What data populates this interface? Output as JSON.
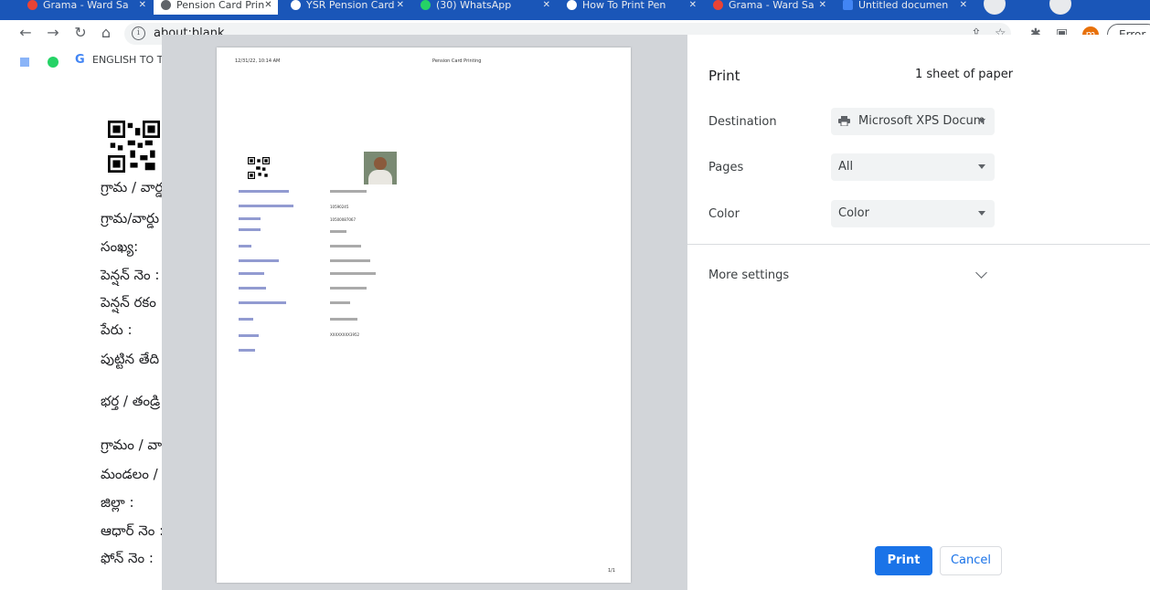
{
  "browser": {
    "tabs": [
      {
        "label": "Grama - Ward Sa",
        "favicon_color": "#ea4335"
      },
      {
        "label": "Pension Card Prin",
        "favicon_color": "#5f6368"
      },
      {
        "label": "YSR Pension Card",
        "favicon_color": "#5f6368"
      },
      {
        "label": "(30) WhatsApp",
        "favicon_color": "#25d366"
      },
      {
        "label": "How To Print Pen",
        "favicon_color": "#5f6368"
      },
      {
        "label": "Grama - Ward Sa",
        "favicon_color": "#ea4335"
      },
      {
        "label": "Untitled documen",
        "favicon_color": "#4285f4"
      }
    ],
    "tab_close": "✕",
    "url": "about:blank",
    "profile_initial": "m",
    "error_label": "Error",
    "bookmarks": {
      "g_letter": "G",
      "label": "ENGLISH TO TE"
    }
  },
  "page_labels": [
    "గ్రామ / వార్డ",
    "గ్రామ/వార్డు",
    "సంఖ్య:",
    "పెన్షన్ నెం :",
    "పెన్షన్ రకం",
    "పేరు :",
    "పుట్టిన తేది",
    "భర్త / తండ్రి",
    "గ్రామం / వా",
    "మండలం /",
    "జిల్లా :",
    "ఆధార్ నెం :",
    "ఫోన్ నెం :"
  ],
  "preview": {
    "header_left": "12/31/22, 10:14 AM",
    "header_center": "Pension Card Printing",
    "footer_page": "1/1",
    "values": [
      "10590245",
      "10500087067",
      "XXXXXXXX3952"
    ]
  },
  "print_panel": {
    "title": "Print",
    "sheets": "1 sheet of paper",
    "destination": {
      "label": "Destination",
      "value": "Microsoft XPS Docum"
    },
    "pages": {
      "label": "Pages",
      "value": "All"
    },
    "color": {
      "label": "Color",
      "value": "Color"
    },
    "more_settings": "More settings",
    "print_button": "Print",
    "cancel_button": "Cancel"
  },
  "colors": {
    "accent": "#1a73e8",
    "tabstrip": "#1a56b8",
    "preview_bg": "#d2d5d9"
  }
}
